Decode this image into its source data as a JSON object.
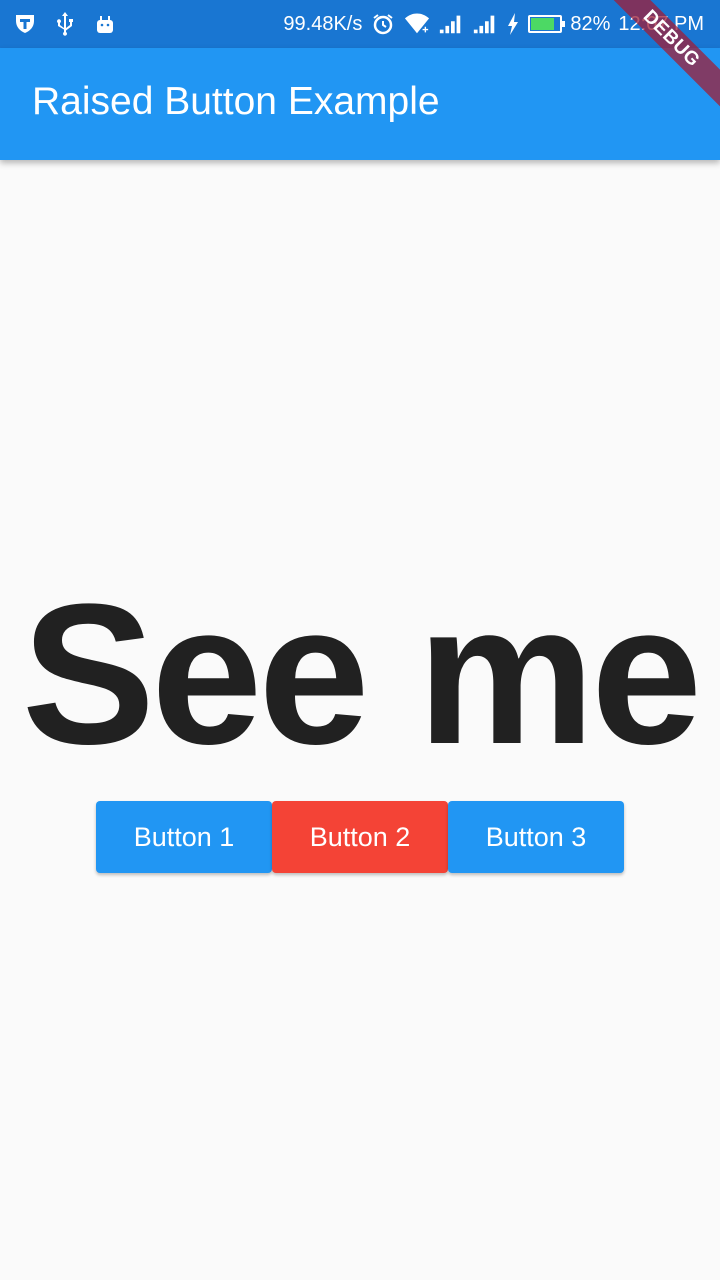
{
  "status_bar": {
    "network_speed": "99.48K/s",
    "battery_percent": "82%",
    "battery_level": 0.82,
    "time": "12:07 PM",
    "icons": [
      "shield-icon",
      "usb-icon",
      "android-icon",
      "alarm-icon",
      "wifi-icon",
      "signal-icon",
      "signal-icon-2",
      "charging-icon",
      "battery-icon"
    ]
  },
  "app_bar": {
    "title": "Raised Button Example"
  },
  "debug_banner": {
    "label": "DEBUG"
  },
  "content": {
    "headline": "See me",
    "buttons": [
      {
        "label": "Button 1",
        "color": "#2196f3"
      },
      {
        "label": "Button 2",
        "color": "#f44336"
      },
      {
        "label": "Button 3",
        "color": "#2196f3"
      }
    ]
  },
  "colors": {
    "status_bar": "#1976d2",
    "app_bar": "#2196f3",
    "background": "#fafafa",
    "headline": "#212121"
  }
}
